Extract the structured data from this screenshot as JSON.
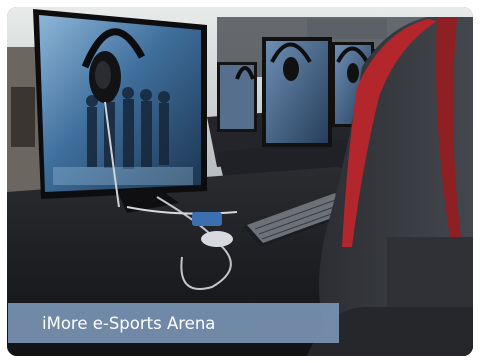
{
  "caption": {
    "text": "iMore e-Sports Arena",
    "background": "#7a94b4",
    "color": "#ffffff"
  },
  "scene": {
    "icons": [
      "gaming-monitor-icon",
      "gaming-headset-icon",
      "mechanical-keyboard-icon",
      "gaming-chair-icon",
      "mouse-icon"
    ],
    "colors": {
      "table": "#1a1b1e",
      "chair_accent": "#b3262b",
      "background_wall": "#d9dcdc",
      "screen_glow": "#4f7fae"
    }
  }
}
